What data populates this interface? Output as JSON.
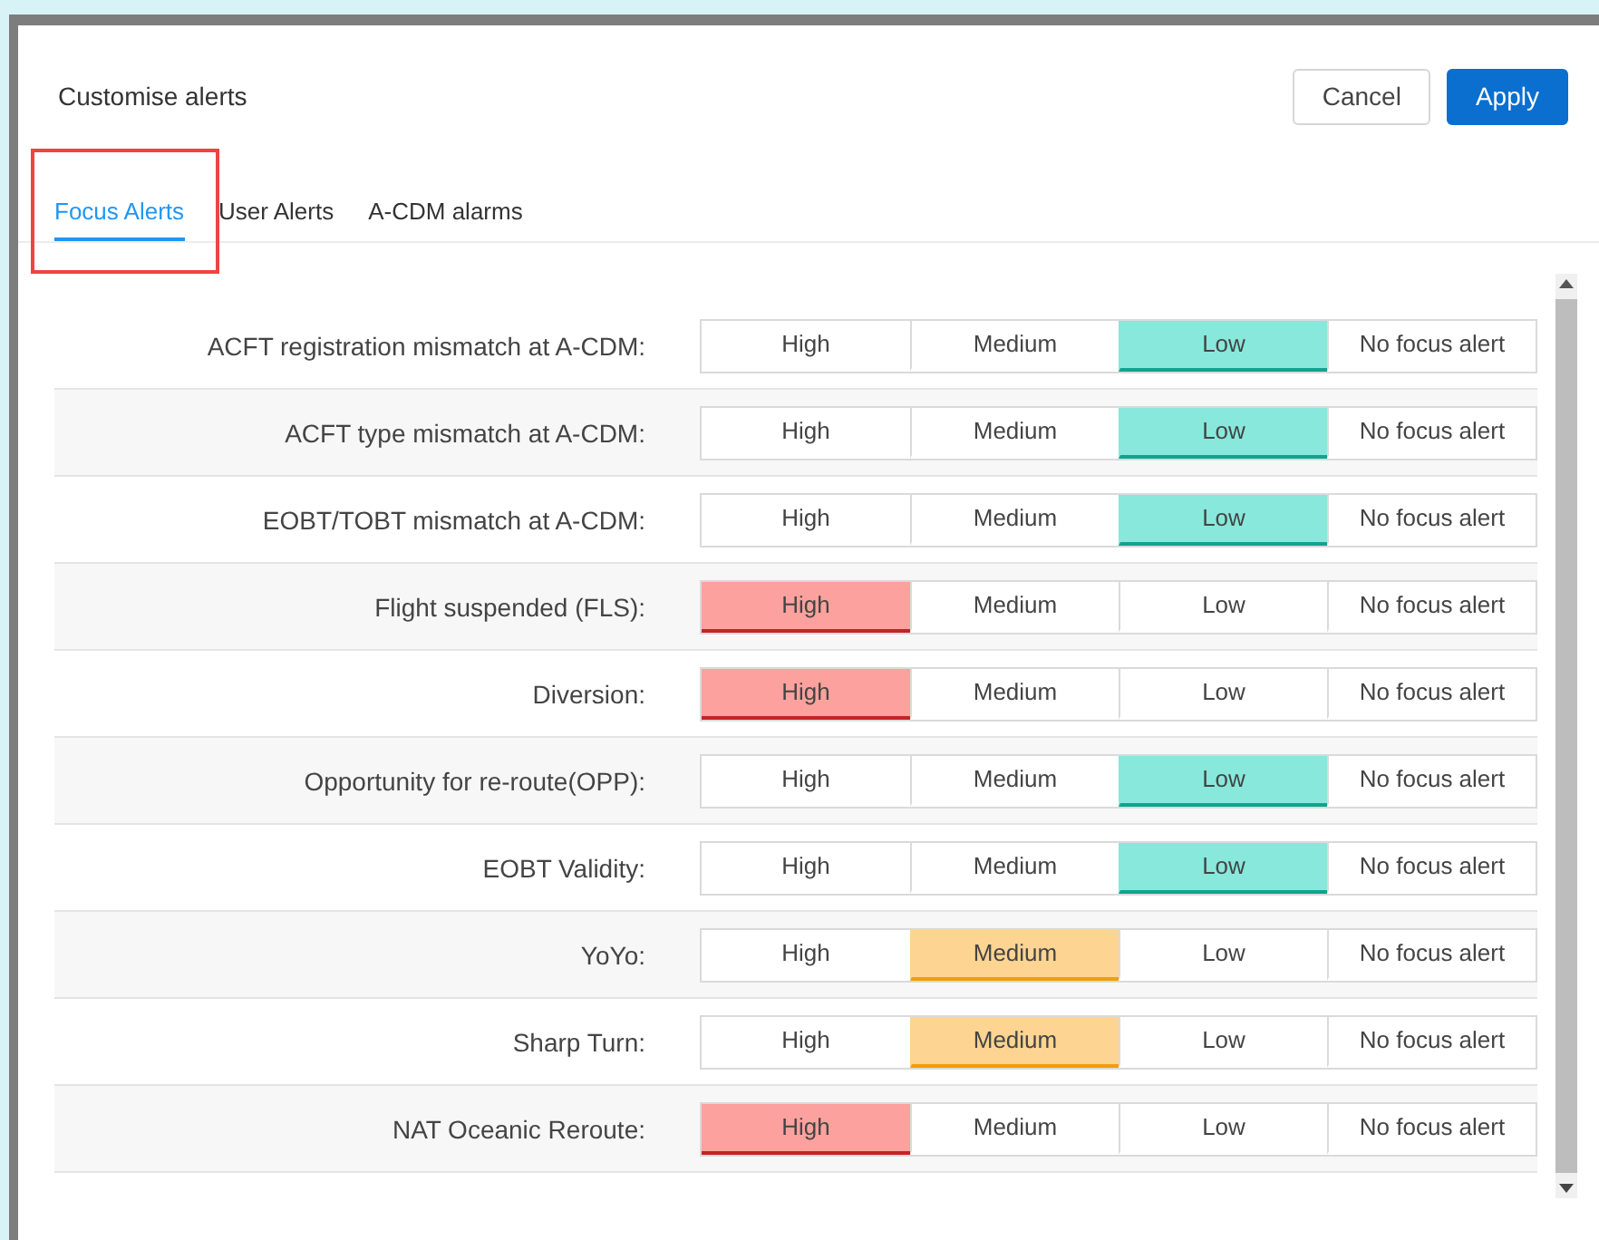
{
  "dialog": {
    "title": "Customise alerts",
    "buttons": [
      {
        "label": "Cancel",
        "kind": "secondary"
      },
      {
        "label": "Apply",
        "kind": "primary"
      }
    ]
  },
  "tabs": [
    {
      "label": "Focus Alerts",
      "selected": true,
      "annotated": true
    },
    {
      "label": "User Alerts",
      "selected": false,
      "annotated": false
    },
    {
      "label": "A-CDM alarms",
      "selected": false,
      "annotated": false
    }
  ],
  "alerts": [
    {
      "label": "ACFT registration mismatch at A-CDM:",
      "options": [
        {
          "label": "High",
          "kind": "high",
          "selected": false
        },
        {
          "label": "Medium",
          "kind": "medium",
          "selected": false
        },
        {
          "label": "Low",
          "kind": "low",
          "selected": true
        },
        {
          "label": "No focus alert",
          "kind": "none",
          "selected": false
        }
      ]
    },
    {
      "label": "ACFT type mismatch at A-CDM:",
      "options": [
        {
          "label": "High",
          "kind": "high",
          "selected": false
        },
        {
          "label": "Medium",
          "kind": "medium",
          "selected": false
        },
        {
          "label": "Low",
          "kind": "low",
          "selected": true
        },
        {
          "label": "No focus alert",
          "kind": "none",
          "selected": false
        }
      ]
    },
    {
      "label": "EOBT/TOBT mismatch at A-CDM:",
      "options": [
        {
          "label": "High",
          "kind": "high",
          "selected": false
        },
        {
          "label": "Medium",
          "kind": "medium",
          "selected": false
        },
        {
          "label": "Low",
          "kind": "low",
          "selected": true
        },
        {
          "label": "No focus alert",
          "kind": "none",
          "selected": false
        }
      ]
    },
    {
      "label": "Flight suspended (FLS):",
      "options": [
        {
          "label": "High",
          "kind": "high",
          "selected": true
        },
        {
          "label": "Medium",
          "kind": "medium",
          "selected": false
        },
        {
          "label": "Low",
          "kind": "low",
          "selected": false
        },
        {
          "label": "No focus alert",
          "kind": "none",
          "selected": false
        }
      ]
    },
    {
      "label": "Diversion:",
      "options": [
        {
          "label": "High",
          "kind": "high",
          "selected": true
        },
        {
          "label": "Medium",
          "kind": "medium",
          "selected": false
        },
        {
          "label": "Low",
          "kind": "low",
          "selected": false
        },
        {
          "label": "No focus alert",
          "kind": "none",
          "selected": false
        }
      ]
    },
    {
      "label": "Opportunity for re-route(OPP):",
      "options": [
        {
          "label": "High",
          "kind": "high",
          "selected": false
        },
        {
          "label": "Medium",
          "kind": "medium",
          "selected": false
        },
        {
          "label": "Low",
          "kind": "low",
          "selected": true
        },
        {
          "label": "No focus alert",
          "kind": "none",
          "selected": false
        }
      ]
    },
    {
      "label": "EOBT Validity:",
      "options": [
        {
          "label": "High",
          "kind": "high",
          "selected": false
        },
        {
          "label": "Medium",
          "kind": "medium",
          "selected": false
        },
        {
          "label": "Low",
          "kind": "low",
          "selected": true
        },
        {
          "label": "No focus alert",
          "kind": "none",
          "selected": false
        }
      ]
    },
    {
      "label": "YoYo:",
      "options": [
        {
          "label": "High",
          "kind": "high",
          "selected": false
        },
        {
          "label": "Medium",
          "kind": "medium",
          "selected": true
        },
        {
          "label": "Low",
          "kind": "low",
          "selected": false
        },
        {
          "label": "No focus alert",
          "kind": "none",
          "selected": false
        }
      ]
    },
    {
      "label": "Sharp Turn:",
      "options": [
        {
          "label": "High",
          "kind": "high",
          "selected": false
        },
        {
          "label": "Medium",
          "kind": "medium",
          "selected": true
        },
        {
          "label": "Low",
          "kind": "low",
          "selected": false
        },
        {
          "label": "No focus alert",
          "kind": "none",
          "selected": false
        }
      ]
    },
    {
      "label": "NAT Oceanic Reroute:",
      "options": [
        {
          "label": "High",
          "kind": "high",
          "selected": true
        },
        {
          "label": "Medium",
          "kind": "medium",
          "selected": false
        },
        {
          "label": "Low",
          "kind": "low",
          "selected": false
        },
        {
          "label": "No focus alert",
          "kind": "none",
          "selected": false
        }
      ]
    }
  ]
}
